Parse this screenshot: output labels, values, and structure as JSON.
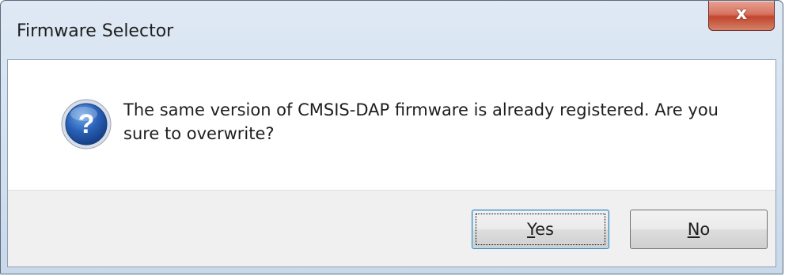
{
  "window": {
    "title": "Firmware Selector",
    "close_glyph": "x"
  },
  "dialog": {
    "icon": "question-icon",
    "message": "The same version of CMSIS-DAP firmware is already registered. Are you sure to overwrite?"
  },
  "buttons": {
    "yes": {
      "accel": "Y",
      "rest": "es"
    },
    "no": {
      "accel": "N",
      "rest": "o"
    }
  },
  "colors": {
    "title_bar": "#c9d9ea",
    "close_button": "#c2452d",
    "button_bar": "#f0f0f0",
    "icon_blue": "#1e4fa0"
  }
}
